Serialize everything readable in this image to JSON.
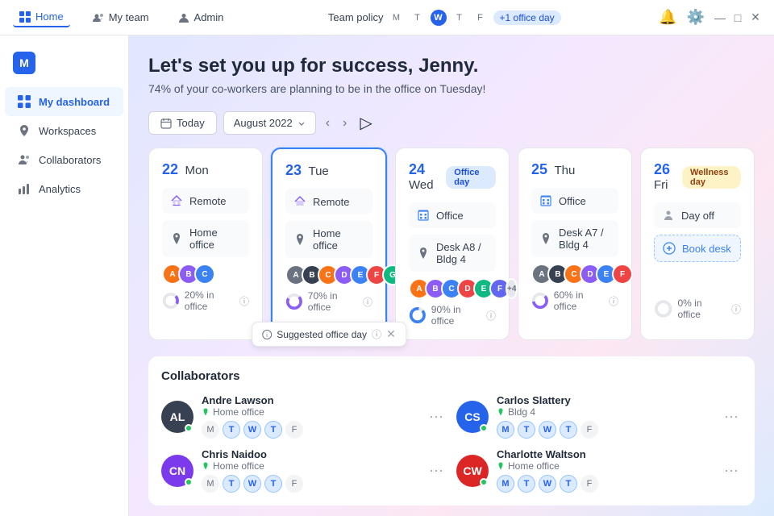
{
  "titleBar": {
    "tabs": [
      {
        "id": "home",
        "label": "Home",
        "active": true,
        "icon": "grid"
      },
      {
        "id": "myteam",
        "label": "My team",
        "active": false,
        "icon": "users"
      },
      {
        "id": "admin",
        "label": "Admin",
        "active": false,
        "icon": "person"
      }
    ],
    "teamPolicy": {
      "label": "Team policy",
      "days": [
        "M",
        "T",
        "W",
        "T",
        "F"
      ],
      "highlightDay": "W",
      "badge": "+1 office day"
    },
    "windowControls": [
      "minimize",
      "maximize",
      "close"
    ]
  },
  "sidebar": {
    "logoText": "M",
    "items": [
      {
        "id": "dashboard",
        "label": "My dashboard",
        "active": true,
        "icon": "grid"
      },
      {
        "id": "workspaces",
        "label": "Workspaces",
        "active": false,
        "icon": "location"
      },
      {
        "id": "collaborators",
        "label": "Collaborators",
        "active": false,
        "icon": "users"
      },
      {
        "id": "analytics",
        "label": "Analytics",
        "active": false,
        "icon": "chart"
      }
    ]
  },
  "main": {
    "heroTitle": "Let's set you up for success, Jenny.",
    "heroSubtitle": "74% of your co-workers are planning to be in the office on Tuesday!",
    "calendarControls": {
      "todayLabel": "Today",
      "monthLabel": "August 2022",
      "monthDropdown": true
    },
    "days": [
      {
        "id": "day22",
        "number": "22",
        "name": "Mon",
        "badge": null,
        "workItems": [
          {
            "type": "remote",
            "icon": "home",
            "label": "Remote"
          },
          {
            "type": "location",
            "icon": "pin",
            "label": "Home office"
          }
        ],
        "avatars": [
          "#f97316",
          "#8b5cf6",
          "#3b82f6"
        ],
        "avatarCount": null,
        "percent": 20,
        "percentLabel": "20% in office",
        "highlighted": false
      },
      {
        "id": "day23",
        "number": "23",
        "name": "Tue",
        "badge": null,
        "workItems": [
          {
            "type": "remote",
            "icon": "home",
            "label": "Remote"
          },
          {
            "type": "location",
            "icon": "pin",
            "label": "Home office"
          }
        ],
        "avatars": [
          "#6b7280",
          "#374151",
          "#f97316",
          "#8b5cf6",
          "#3b82f6",
          "#ef4444",
          "#10b981"
        ],
        "avatarCount": null,
        "percent": 70,
        "percentLabel": "70% in office",
        "highlighted": true,
        "suggested": "Suggested office day"
      },
      {
        "id": "day24",
        "number": "24",
        "name": "Wed",
        "badge": {
          "label": "Office day",
          "type": "office"
        },
        "workItems": [
          {
            "type": "office",
            "icon": "building",
            "label": "Office"
          },
          {
            "type": "location",
            "icon": "pin",
            "label": "Desk A8 / Bldg 4"
          }
        ],
        "avatars": [
          "#f97316",
          "#8b5cf6",
          "#3b82f6",
          "#ef4444",
          "#10b981",
          "#6366f1"
        ],
        "avatarCount": "+4",
        "percent": 90,
        "percentLabel": "90% in office",
        "highlighted": false
      },
      {
        "id": "day25",
        "number": "25",
        "name": "Thu",
        "badge": null,
        "workItems": [
          {
            "type": "office",
            "icon": "building",
            "label": "Office"
          },
          {
            "type": "location",
            "icon": "pin",
            "label": "Desk A7 / Bldg 4"
          }
        ],
        "avatars": [
          "#6b7280",
          "#374151",
          "#f97316",
          "#8b5cf6",
          "#3b82f6",
          "#ef4444"
        ],
        "avatarCount": null,
        "percent": 60,
        "percentLabel": "60% in office",
        "highlighted": false
      },
      {
        "id": "day26",
        "number": "26",
        "name": "Fri",
        "badge": {
          "label": "Wellness day",
          "type": "wellness"
        },
        "workItems": [
          {
            "type": "dayoff",
            "icon": "person",
            "label": "Day off"
          },
          {
            "type": "book",
            "icon": "plus",
            "label": "Book desk"
          }
        ],
        "avatars": [],
        "avatarCount": null,
        "percent": 0,
        "percentLabel": "0% in office",
        "highlighted": false
      }
    ],
    "collaborators": {
      "title": "Collaborators",
      "items": [
        {
          "id": "andre",
          "name": "Andre Lawson",
          "location": "Home office",
          "locationIcon": "pin",
          "days": [
            "M",
            "T",
            "W",
            "T",
            "F"
          ],
          "activeDays": [
            "W",
            "T"
          ],
          "online": true,
          "avatarColor": "#374151",
          "initials": "AL"
        },
        {
          "id": "carlos",
          "name": "Carlos Slattery",
          "location": "Bldg 4",
          "locationIcon": "pin",
          "days": [
            "M",
            "T",
            "W",
            "T",
            "F"
          ],
          "activeDays": [
            "W",
            "T"
          ],
          "online": true,
          "avatarColor": "#2563eb",
          "initials": "CS"
        },
        {
          "id": "chris",
          "name": "Chris Naidoo",
          "location": "Home office",
          "locationIcon": "pin",
          "days": [
            "M",
            "T",
            "W",
            "T",
            "F"
          ],
          "activeDays": [
            "T",
            "W"
          ],
          "online": false,
          "avatarColor": "#7c3aed",
          "initials": "CN"
        },
        {
          "id": "charlotte",
          "name": "Charlotte Waltson",
          "location": "Home office",
          "locationIcon": "pin",
          "days": [
            "M",
            "T",
            "W",
            "T",
            "F"
          ],
          "activeDays": [
            "T",
            "W"
          ],
          "online": false,
          "avatarColor": "#dc2626",
          "initials": "CW"
        }
      ]
    }
  }
}
